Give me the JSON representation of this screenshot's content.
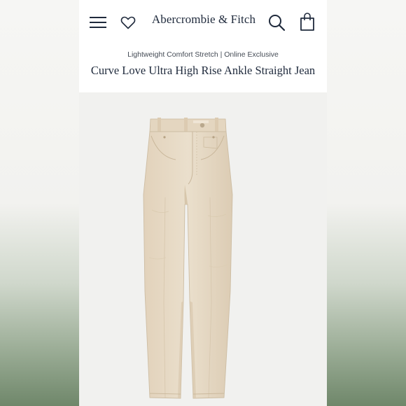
{
  "header": {
    "brand": "Abercrombie & Fitch",
    "icons": {
      "menu": "hamburger-menu-icon",
      "wishlist": "heart-icon",
      "search": "search-icon",
      "bag": "shopping-bag-icon"
    }
  },
  "product": {
    "eyebrow": "Lightweight Comfort Stretch | Online Exclusive",
    "title": "Curve Love Ultra High Rise Ankle Straight Jean",
    "image_alt": "beige straight jeans"
  },
  "colors": {
    "text_primary": "#1f2a3c",
    "jean_beige": "#e6d8c2",
    "background": "#f1f1ef"
  }
}
